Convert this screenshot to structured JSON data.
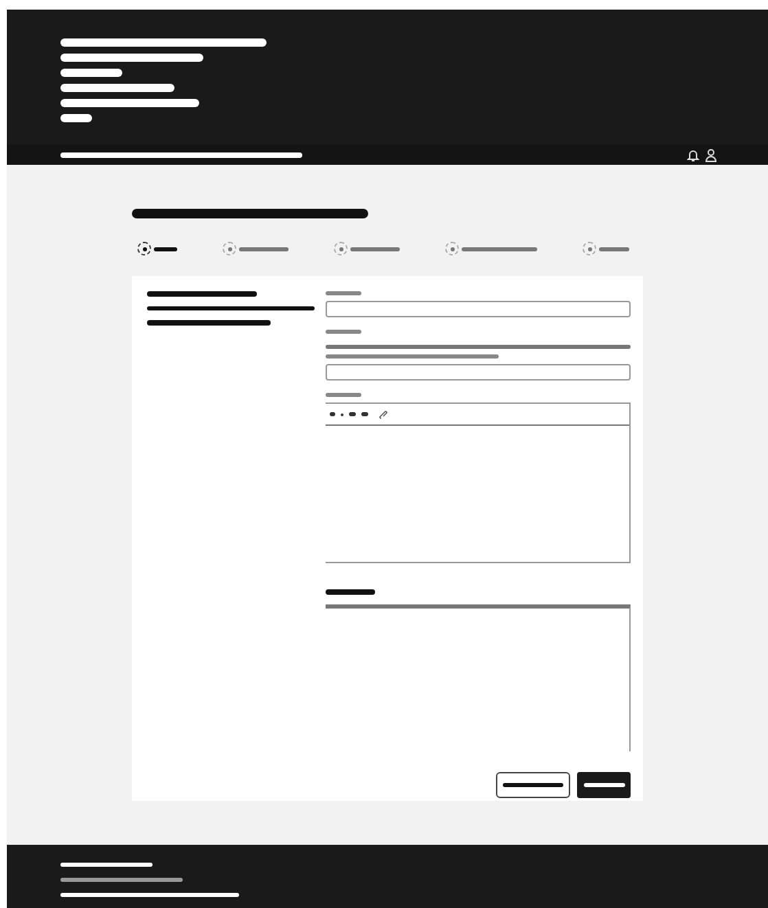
{
  "header": {
    "lines": [
      {
        "kind": "redacted"
      },
      {
        "kind": "redacted"
      },
      {
        "kind": "redacted"
      },
      {
        "kind": "redacted"
      },
      {
        "kind": "redacted"
      },
      {
        "kind": "redacted"
      }
    ]
  },
  "nav": {
    "lines": [
      {
        "kind": "redacted"
      }
    ]
  },
  "title": {
    "kind": "redacted"
  },
  "steps": [
    {
      "selected": true
    },
    {
      "selected": false
    },
    {
      "selected": false
    },
    {
      "selected": false
    },
    {
      "selected": false
    }
  ],
  "sidebar": {
    "lines": [
      {
        "kind": "redacted"
      },
      {
        "kind": "redacted"
      },
      {
        "kind": "redacted"
      }
    ]
  },
  "fields": [
    {
      "kind": "input"
    },
    {
      "kind": "input_with_hint"
    },
    {
      "kind": "rich_editor"
    },
    {
      "kind": "textarea"
    }
  ],
  "buttons": [
    {
      "kind": "secondary"
    },
    {
      "kind": "primary"
    }
  ],
  "footer": {
    "lines": [
      {
        "kind": "redacted",
        "muted": false
      },
      {
        "kind": "redacted",
        "muted": true
      },
      {
        "kind": "redacted",
        "muted": false
      }
    ]
  }
}
